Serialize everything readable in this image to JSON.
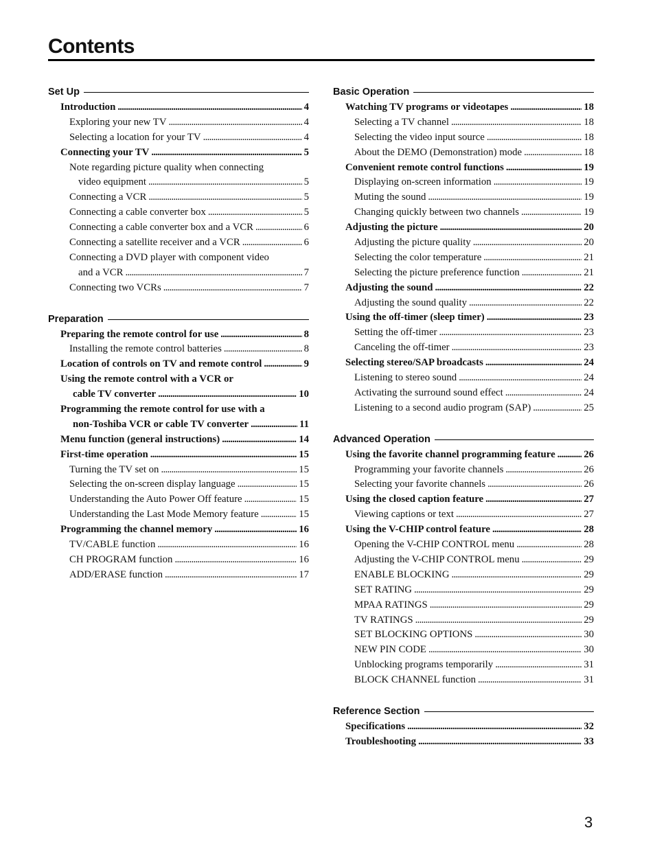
{
  "page_title": "Contents",
  "page_number": "3",
  "left_column": [
    {
      "heading": "Set Up",
      "entries": [
        {
          "level": 1,
          "text": "Introduction",
          "page": "4"
        },
        {
          "level": 2,
          "text": "Exploring your new TV",
          "page": "4"
        },
        {
          "level": 2,
          "text": "Selecting a location for your TV",
          "page": "4"
        },
        {
          "level": 1,
          "text": "Connecting your TV",
          "page": "5"
        },
        {
          "level": 2,
          "text": "Note regarding picture quality when connecting",
          "page": ""
        },
        {
          "level": 3,
          "text": "video equipment",
          "page": "5"
        },
        {
          "level": 2,
          "text": "Connecting a VCR",
          "page": "5"
        },
        {
          "level": 2,
          "text": "Connecting a cable converter box",
          "page": "5"
        },
        {
          "level": 2,
          "text": "Connecting a cable converter box and a VCR",
          "page": "6"
        },
        {
          "level": 2,
          "text": "Connecting a satellite receiver and a VCR",
          "page": "6"
        },
        {
          "level": 2,
          "text": "Connecting a DVD player with component video",
          "page": ""
        },
        {
          "level": 3,
          "text": "and a VCR",
          "page": "7"
        },
        {
          "level": 2,
          "text": "Connecting two VCRs",
          "page": "7"
        }
      ]
    },
    {
      "heading": "Preparation",
      "entries": [
        {
          "level": 1,
          "text": "Preparing the remote control for use",
          "page": "8"
        },
        {
          "level": 2,
          "text": "Installing the remote control batteries",
          "page": "8"
        },
        {
          "level": 1,
          "text": "Location of controls on TV and remote control",
          "page": "9"
        },
        {
          "level": 1,
          "text": "Using the remote control with a VCR or",
          "page": ""
        },
        {
          "level": 4,
          "text": "cable TV converter",
          "page": "10"
        },
        {
          "level": 1,
          "text": "Programming the remote control for use with a",
          "page": ""
        },
        {
          "level": 4,
          "text": "non-Toshiba VCR or cable TV converter",
          "page": "11"
        },
        {
          "level": 1,
          "text": "Menu function (general instructions)",
          "page": "14"
        },
        {
          "level": 1,
          "text": "First-time operation",
          "page": "15"
        },
        {
          "level": 2,
          "text": "Turning the TV set on",
          "page": "15"
        },
        {
          "level": 2,
          "text": "Selecting the on-screen display language",
          "page": "15"
        },
        {
          "level": 2,
          "text": "Understanding the Auto Power Off feature",
          "page": "15"
        },
        {
          "level": 2,
          "text": "Understanding the Last Mode Memory feature",
          "page": "15"
        },
        {
          "level": 1,
          "text": "Programming the channel memory",
          "page": "16"
        },
        {
          "level": 2,
          "text": "TV/CABLE function",
          "page": "16"
        },
        {
          "level": 2,
          "text": "CH PROGRAM function",
          "page": "16"
        },
        {
          "level": 2,
          "text": "ADD/ERASE function",
          "page": "17"
        }
      ]
    }
  ],
  "right_column": [
    {
      "heading": "Basic Operation",
      "entries": [
        {
          "level": 1,
          "text": "Watching TV programs or videotapes",
          "page": "18"
        },
        {
          "level": 2,
          "text": "Selecting a TV channel",
          "page": "18"
        },
        {
          "level": 2,
          "text": "Selecting the video input source",
          "page": "18"
        },
        {
          "level": 2,
          "text": "About the DEMO (Demonstration) mode",
          "page": "18"
        },
        {
          "level": 1,
          "text": "Convenient remote control functions",
          "page": "19"
        },
        {
          "level": 2,
          "text": "Displaying on-screen information",
          "page": "19"
        },
        {
          "level": 2,
          "text": "Muting the sound",
          "page": "19"
        },
        {
          "level": 2,
          "text": "Changing quickly between two channels",
          "page": "19"
        },
        {
          "level": 1,
          "text": "Adjusting the picture",
          "page": "20"
        },
        {
          "level": 2,
          "text": "Adjusting the picture quality",
          "page": "20"
        },
        {
          "level": 2,
          "text": "Selecting the color temperature",
          "page": "21"
        },
        {
          "level": 2,
          "text": "Selecting the picture preference function",
          "page": "21"
        },
        {
          "level": 1,
          "text": "Adjusting the sound",
          "page": "22"
        },
        {
          "level": 2,
          "text": "Adjusting the sound quality",
          "page": "22"
        },
        {
          "level": 1,
          "text": "Using the off-timer (sleep timer)",
          "page": "23"
        },
        {
          "level": 2,
          "text": "Setting the off-timer",
          "page": "23"
        },
        {
          "level": 2,
          "text": "Canceling the off-timer",
          "page": "23"
        },
        {
          "level": 1,
          "text": "Selecting stereo/SAP broadcasts",
          "page": "24"
        },
        {
          "level": 2,
          "text": "Listening to stereo sound",
          "page": "24"
        },
        {
          "level": 2,
          "text": "Activating the surround sound effect",
          "page": "24"
        },
        {
          "level": 2,
          "text": "Listening to a second audio program (SAP)",
          "page": "25"
        }
      ]
    },
    {
      "heading": "Advanced Operation",
      "entries": [
        {
          "level": 1,
          "text": "Using the favorite channel programming feature",
          "page": "26"
        },
        {
          "level": 2,
          "text": "Programming your favorite channels",
          "page": "26"
        },
        {
          "level": 2,
          "text": "Selecting your favorite channels",
          "page": "26"
        },
        {
          "level": 1,
          "text": "Using the closed caption feature",
          "page": "27"
        },
        {
          "level": 2,
          "text": "Viewing captions or text",
          "page": "27"
        },
        {
          "level": 1,
          "text": "Using the V-CHIP control feature",
          "page": "28"
        },
        {
          "level": 2,
          "text": "Opening the V-CHIP CONTROL menu",
          "page": "28"
        },
        {
          "level": 2,
          "text": "Adjusting the V-CHIP CONTROL menu",
          "page": "29"
        },
        {
          "level": 2,
          "text": "ENABLE BLOCKING",
          "page": "29"
        },
        {
          "level": 2,
          "text": "SET RATING",
          "page": "29"
        },
        {
          "level": 2,
          "text": "MPAA RATINGS",
          "page": "29"
        },
        {
          "level": 2,
          "text": "TV RATINGS",
          "page": "29"
        },
        {
          "level": 2,
          "text": "SET BLOCKING OPTIONS",
          "page": "30"
        },
        {
          "level": 2,
          "text": "NEW PIN CODE",
          "page": "30"
        },
        {
          "level": 2,
          "text": "Unblocking programs temporarily",
          "page": "31"
        },
        {
          "level": 2,
          "text": "BLOCK CHANNEL function",
          "page": "31"
        }
      ]
    },
    {
      "heading": "Reference Section",
      "entries": [
        {
          "level": 1,
          "text": "Specifications",
          "page": "32"
        },
        {
          "level": 1,
          "text": "Troubleshooting",
          "page": "33"
        }
      ]
    }
  ]
}
